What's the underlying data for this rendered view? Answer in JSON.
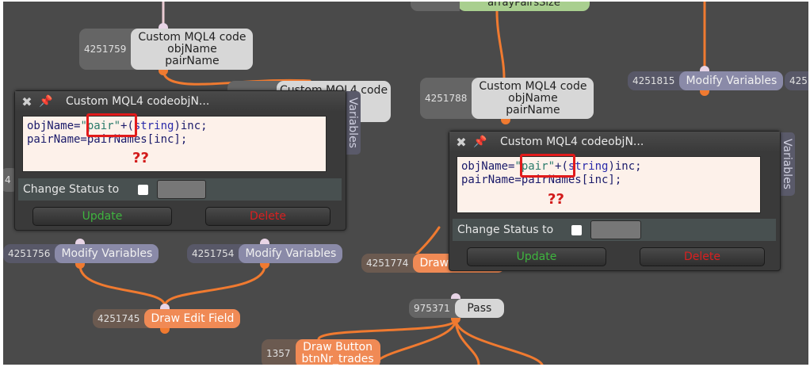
{
  "nodes": {
    "top_green": {
      "label": "arrayPairsSize"
    },
    "code_top": {
      "id": "4251759",
      "line1": "Custom MQL4 code",
      "line2": "objName",
      "line3": "pairName"
    },
    "code_behind": {
      "line1": "Custom MQL4 code"
    },
    "code_mid": {
      "id": "4251788",
      "line1": "Custom MQL4 code",
      "line2": "objName",
      "line3": "pairName"
    },
    "modify_right": {
      "id": "4251815",
      "label": "Modify Variables"
    },
    "modify_right_cut": {
      "id": "425"
    },
    "modify_a": {
      "id": "4251756",
      "label": "Modify Variables"
    },
    "modify_b": {
      "id": "4251754",
      "label": "Modify Variables"
    },
    "draw_cut": {
      "id": "4251774",
      "label": "Draw"
    },
    "draw_edit": {
      "id": "4251745",
      "label": "Draw Edit Field"
    },
    "pass": {
      "id": "975371",
      "label": "Pass"
    },
    "draw_button": {
      "id": "1357",
      "line1": "Draw Button",
      "line2": "btnNr_trades"
    },
    "left_cut": {
      "id": "4"
    }
  },
  "panels": [
    {
      "title": "Custom MQL4 codeobjN...",
      "code": {
        "l1_a": "objName=",
        "l1_str": "\"pair\"",
        "l1_b": "+(",
        "l1_kw": "string",
        "l1_c": ")inc;",
        "l2": "pairName=pairNames[inc];"
      },
      "annotation": "??",
      "status_label": "Change Status to",
      "update_label": "Update",
      "delete_label": "Delete",
      "side_tab": "Variables"
    },
    {
      "title": "Custom MQL4 codeobjN...",
      "code": {
        "l1_a": "objName=",
        "l1_str": "\"pair\"",
        "l1_b": "+(",
        "l1_kw": "string",
        "l1_c": ")inc;",
        "l2": "pairName=pairNames[inc];"
      },
      "annotation": "??",
      "status_label": "Change Status to",
      "update_label": "Update",
      "delete_label": "Delete",
      "side_tab": "Variables"
    }
  ],
  "icons": {
    "close": "close-icon",
    "pin": "pin-icon"
  },
  "colors": {
    "canvas": "#4a4a4a",
    "wire": "#f07a30",
    "highlight": "#e21a1a",
    "annotation": "#d21a1a",
    "update": "#3fb43f",
    "delete": "#d82020"
  }
}
